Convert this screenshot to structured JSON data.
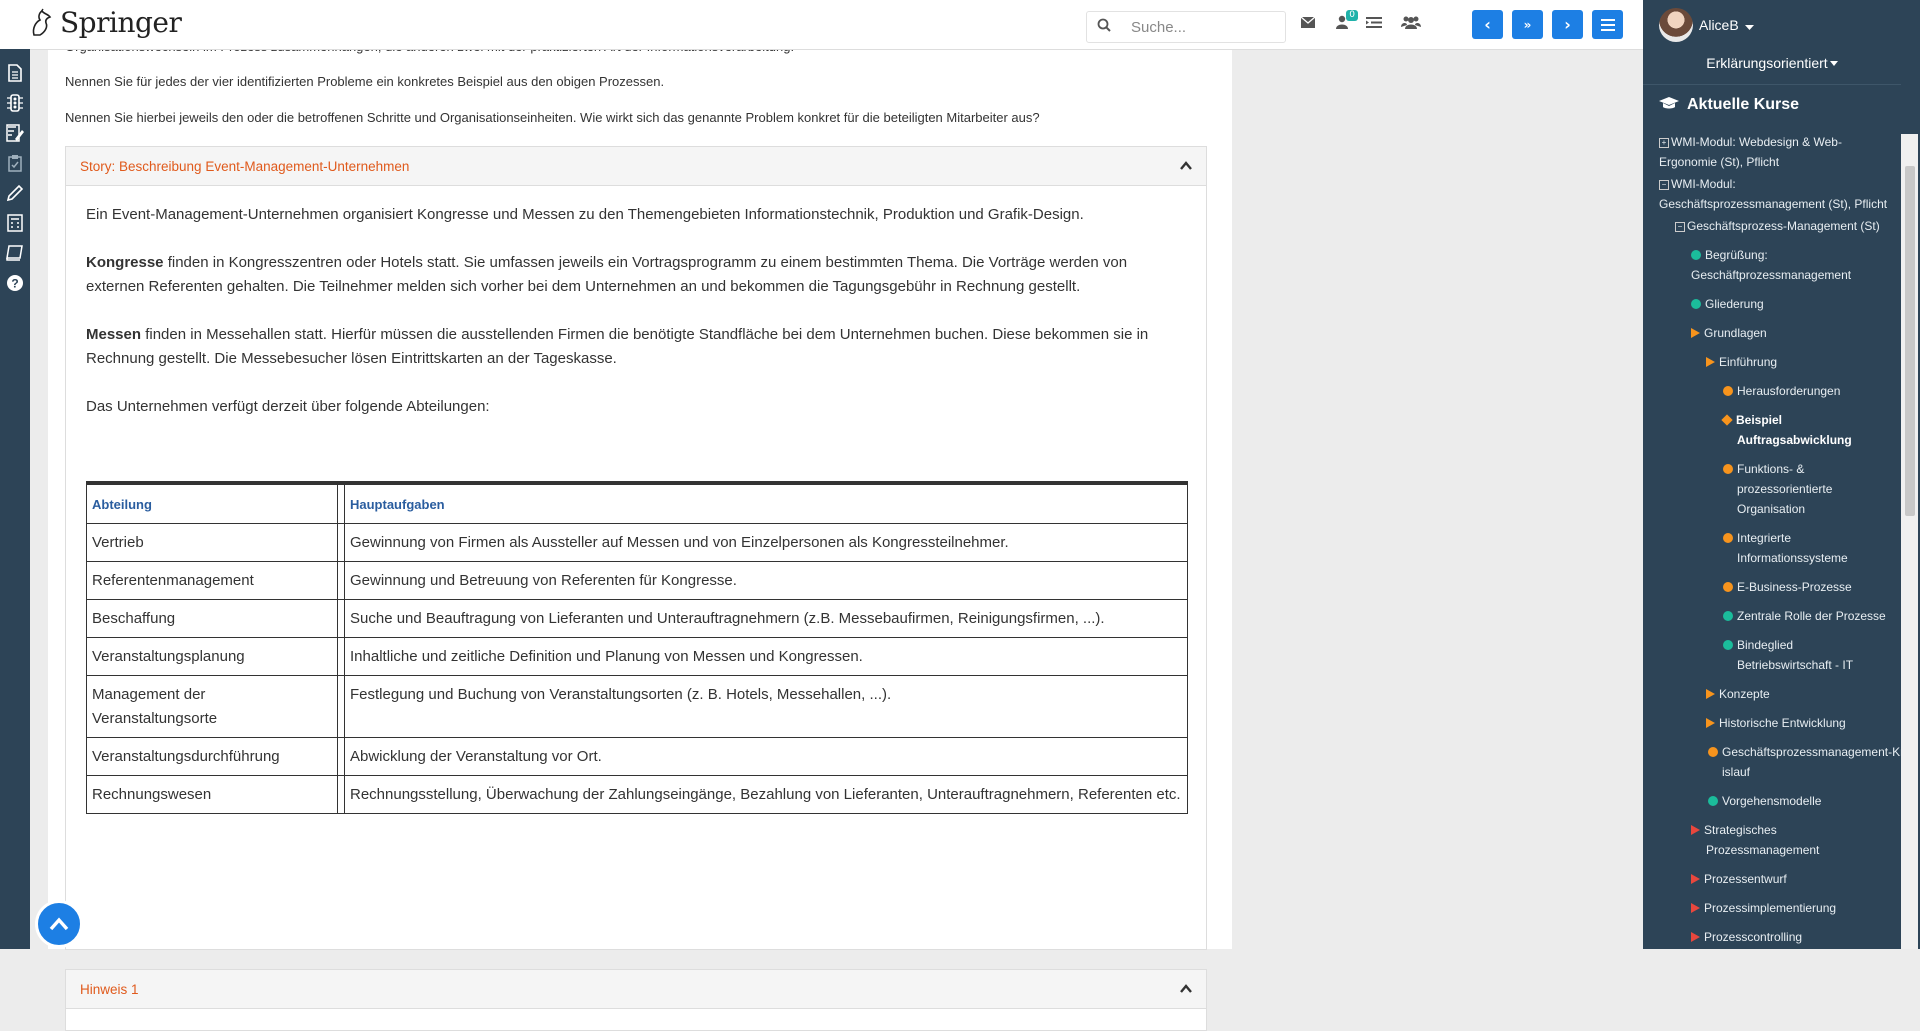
{
  "topbar": {
    "brand": "Springer",
    "search_placeholder": "Suche...",
    "badge_count": "0",
    "icons": [
      "search-icon",
      "envelope-icon",
      "user-notification-icon",
      "indent-list-icon",
      "users-icon"
    ],
    "nav_buttons": [
      "chevron-left-icon",
      "double-chevron-down-icon",
      "chevron-right-icon",
      "hamburger-menu-icon"
    ]
  },
  "left_strip": [
    "document-icon",
    "traffic-light-icon",
    "edit-note-icon",
    "clipboard-check-icon",
    "pencil-icon",
    "calculator-icon",
    "book-icon",
    "help-icon"
  ],
  "content": {
    "line_cut": "Organisationswechseln im Prozess zusammenhängen, die anderen zwei mit der praktizierten Art der Informationsverarbeitung.",
    "para1": "Nennen Sie für jedes der vier identifizierten Probleme ein konkretes Beispiel aus den obigen Prozessen.",
    "para2": "Nennen Sie hierbei jeweils den oder die betroffenen Schritte und Organisationseinheiten. Wie wirkt sich das genannte Problem konkret für die beteiligten Mitarbeiter aus?",
    "story_title": "Story: Beschreibung Event-Management-Unternehmen",
    "story_intro": "Ein Event-Management-Unternehmen organisiert Kongresse und Messen zu den Themengebieten Informationstechnik, Produktion und Grafik-Design.",
    "kongresse_bold": "Kongresse",
    "kongresse_text": " finden in Kongresszentren oder Hotels statt. Sie umfassen jeweils ein Vortragsprogramm zu einem bestimmten Thema. Die Vorträge werden von externen Referenten gehalten. Die Teilnehmer melden sich vorher bei dem Unternehmen an und bekommen die Tagungsgebühr in Rechnung gestellt.",
    "messen_bold": "Messen",
    "messen_text": " finden in Messehallen statt. Hierfür müssen die ausstellenden Firmen die benötigte Standfläche bei dem Unternehmen buchen. Diese bekommen sie in Rechnung gestellt. Die Messebesucher lösen Eintrittskarten an der Tageskasse.",
    "abteilungen_intro": "Das Unternehmen verfügt derzeit über folgende Abteilungen:",
    "table": {
      "headers": [
        "Abteilung",
        "Hauptaufgaben"
      ],
      "rows": [
        [
          "Vertrieb",
          "Gewinnung von Firmen als Aussteller auf Messen und von Einzelpersonen als Kongressteilnehmer."
        ],
        [
          "Referentenmanagement",
          "Gewinnung und Betreuung von Referenten für Kongresse."
        ],
        [
          "Beschaffung",
          "Suche und Beauftragung von Lieferanten und Unterauftragnehmern (z.B. Messebaufirmen, Reinigungsfirmen, ...)."
        ],
        [
          "Veranstaltungsplanung",
          "Inhaltliche und zeitliche Definition und Planung von Messen und Kongressen."
        ],
        [
          "Management der Veranstaltungsorte",
          "Festlegung und Buchung von Veranstaltungsorten (z. B. Hotels, Messehallen, ...)."
        ],
        [
          "Veranstaltungsdurchführung",
          "Abwicklung der Veranstaltung vor Ort."
        ],
        [
          "Rechnungswesen",
          "Rechnungsstellung, Überwachung der Zahlungseingänge, Bezahlung von Lieferanten, Unterauftragnehmern, Referenten etc."
        ]
      ]
    },
    "hint_title": "Hinweis 1"
  },
  "sidebar": {
    "user": "AliceB",
    "mode": "Erklärungsorientiert",
    "heading": "Aktuelle Kurse",
    "tree": [
      {
        "label": "WMI-Modul: Webdesign & Web-Ergonomie (St), Pflicht",
        "marker": "plus"
      },
      {
        "label": "WMI-Modul: Geschäftsprozessmanagement (St), Pflicht",
        "marker": "minus"
      },
      {
        "label": "Geschäftsprozess-Management (St)",
        "marker": "minus"
      },
      {
        "label": "Begrüßung: Geschäftprozessmanagement",
        "marker": "dot-teal"
      },
      {
        "label": "Gliederung",
        "marker": "dot-teal"
      },
      {
        "label": "Grundlagen",
        "marker": "tri-orange"
      },
      {
        "label": "Einführung",
        "marker": "tri-orange"
      },
      {
        "label": "Herausforderungen",
        "marker": "dot-orange"
      },
      {
        "label": "Beispiel Auftragsabwicklung",
        "marker": "diamond"
      },
      {
        "label": "Funktions- & prozessorientierte Organisation",
        "marker": "dot-orange"
      },
      {
        "label": "Integrierte Informationssysteme",
        "marker": "dot-orange"
      },
      {
        "label": "E-Business-Prozesse",
        "marker": "dot-orange"
      },
      {
        "label": "Zentrale Rolle der Prozesse",
        "marker": "dot-teal"
      },
      {
        "label": "Bindeglied Betriebswirtschaft - IT",
        "marker": "dot-teal"
      },
      {
        "label": "Konzepte",
        "marker": "tri-orange"
      },
      {
        "label": "Historische Entwicklung",
        "marker": "tri-orange"
      },
      {
        "label": "Geschäftsprozessmanagement-Kreislauf",
        "marker": "dot-orange"
      },
      {
        "label": "Vorgehensmodelle",
        "marker": "dot-teal"
      },
      {
        "label": "Strategisches Prozessmanagement",
        "marker": "tri-red"
      },
      {
        "label": "Prozessentwurf",
        "marker": "tri-red"
      },
      {
        "label": "Prozessimplementierung",
        "marker": "tri-red"
      },
      {
        "label": "Prozesscontrolling",
        "marker": "tri-red"
      }
    ]
  },
  "colors": {
    "accent_blue": "#1d7fe4",
    "sidebar_bg": "#2d4457",
    "panel_title": "#e05a1c",
    "teal": "#1bbc9b",
    "orange": "#f7941d",
    "red": "#e8473d",
    "table_header": "#2a5d9f"
  }
}
